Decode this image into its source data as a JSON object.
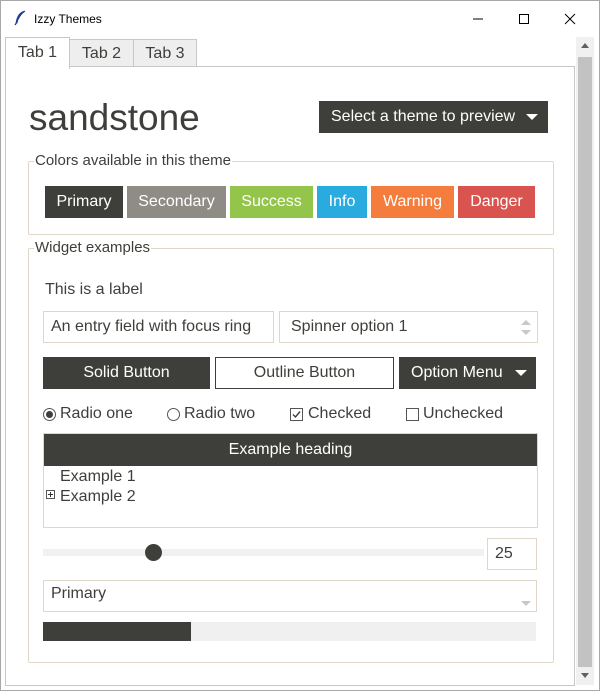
{
  "window": {
    "title": "Izzy Themes"
  },
  "tabs": [
    "Tab 1",
    "Tab 2",
    "Tab 3"
  ],
  "theme": {
    "name": "sandstone",
    "select_label": "Select a theme to preview"
  },
  "colors_group": {
    "title": "Colors available in this theme",
    "swatches": [
      {
        "label": "Primary",
        "color": "#3e3f3a"
      },
      {
        "label": "Secondary",
        "color": "#8e8c84"
      },
      {
        "label": "Success",
        "color": "#93c54b"
      },
      {
        "label": "Info",
        "color": "#29abe0"
      },
      {
        "label": "Warning",
        "color": "#f47c3c"
      },
      {
        "label": "Danger",
        "color": "#d9534f"
      }
    ]
  },
  "widgets_group": {
    "title": "Widget examples",
    "label": "This is a label",
    "entry_value": "An entry field with focus ring",
    "spinner_value": "Spinner option 1",
    "buttons": {
      "solid": "Solid Button",
      "outline": "Outline Button",
      "option_menu": "Option Menu"
    },
    "radios": [
      {
        "label": "Radio one",
        "selected": true
      },
      {
        "label": "Radio two",
        "selected": false
      }
    ],
    "checks": [
      {
        "label": "Checked",
        "checked": true
      },
      {
        "label": "Unchecked",
        "checked": false
      }
    ],
    "tree": {
      "heading": "Example heading",
      "items": [
        "Example 1",
        "Example 2"
      ]
    },
    "scale": {
      "value": 25,
      "spin_value": "25",
      "min": 0,
      "max": 100
    },
    "combobox_value": "Primary",
    "progress": {
      "value": 30
    }
  },
  "accent_color": "#3e3f3a"
}
